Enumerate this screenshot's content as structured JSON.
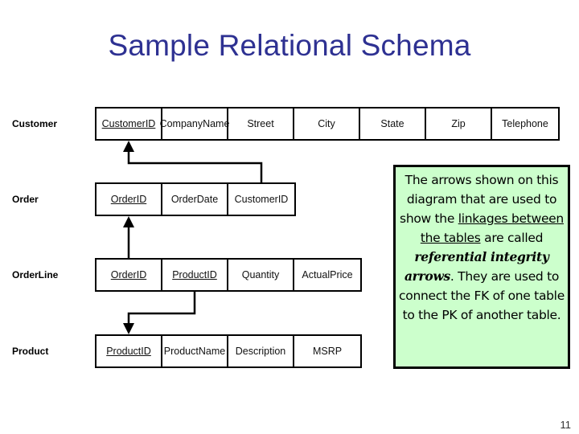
{
  "title": "Sample Relational Schema",
  "tables": [
    {
      "name": "Customer",
      "columns": [
        {
          "label": "CustomerID",
          "pk": true
        },
        {
          "label": "CompanyName",
          "pk": false
        },
        {
          "label": "Street",
          "pk": false
        },
        {
          "label": "City",
          "pk": false
        },
        {
          "label": "State",
          "pk": false
        },
        {
          "label": "Zip",
          "pk": false
        },
        {
          "label": "Telephone",
          "pk": false
        }
      ]
    },
    {
      "name": "Order",
      "columns": [
        {
          "label": "OrderID",
          "pk": true
        },
        {
          "label": "OrderDate",
          "pk": false
        },
        {
          "label": "CustomerID",
          "pk": false
        }
      ]
    },
    {
      "name": "OrderLine",
      "columns": [
        {
          "label": "OrderID",
          "pk": true
        },
        {
          "label": "ProductID",
          "pk": true
        },
        {
          "label": "Quantity",
          "pk": false
        },
        {
          "label": "ActualPrice",
          "pk": false
        }
      ]
    },
    {
      "name": "Product",
      "columns": [
        {
          "label": "ProductID",
          "pk": true
        },
        {
          "label": "ProductName",
          "pk": false
        },
        {
          "label": "Description",
          "pk": false
        },
        {
          "label": "MSRP",
          "pk": false
        }
      ]
    }
  ],
  "relationships": [
    {
      "from": "Order.CustomerID",
      "to": "Customer.CustomerID"
    },
    {
      "from": "OrderLine.OrderID",
      "to": "Order.OrderID"
    },
    {
      "from": "OrderLine.ProductID",
      "to": "Product.ProductID"
    }
  ],
  "note": {
    "part1": "The arrows shown on this diagram that are used to show the ",
    "underlined": "linkages between the tables",
    "part2": " are called ",
    "emphasis": "referential integrity arrows",
    "part3": ".  They are used to connect the FK of one table to the PK of another table.",
    "background": "#ccffcc"
  },
  "page_number": "11",
  "colors": {
    "title": "#2e3192",
    "note_bg": "#ccffcc"
  }
}
